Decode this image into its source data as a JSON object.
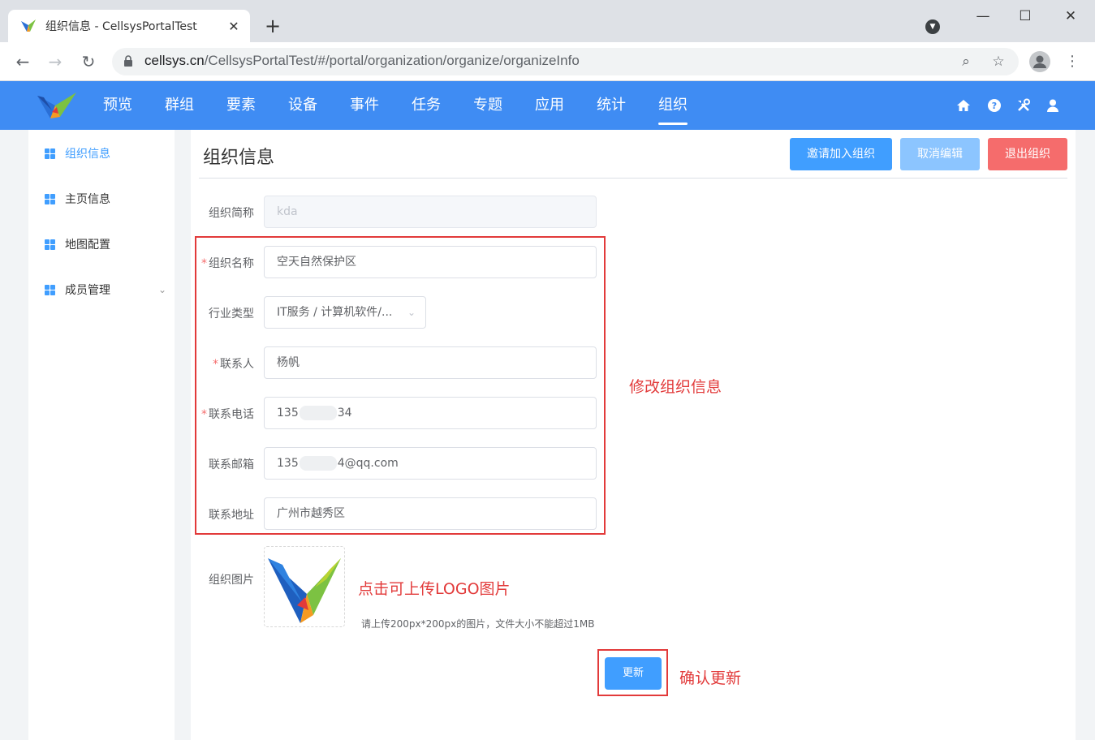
{
  "browser": {
    "tab_title": "组织信息 - CellsysPortalTest",
    "tab_close": "✕",
    "new_tab": "+",
    "url_host": "cellsys.cn",
    "url_path": "/CellsysPortalTest/#/portal/organization/organize/organizeInfo",
    "window_controls": [
      "—",
      "☐",
      "✕"
    ]
  },
  "nav": {
    "menu": [
      "预览",
      "群组",
      "要素",
      "设备",
      "事件",
      "任务",
      "专题",
      "应用",
      "统计",
      "组织"
    ],
    "active": "组织",
    "icons": [
      "home-icon",
      "help-icon",
      "tools-icon",
      "user-icon"
    ]
  },
  "sidebar": {
    "items": [
      {
        "label": "组织信息",
        "active": true
      },
      {
        "label": "主页信息",
        "active": false
      },
      {
        "label": "地图配置",
        "active": false
      },
      {
        "label": "成员管理",
        "active": false,
        "expandable": true
      }
    ]
  },
  "page": {
    "title": "组织信息",
    "buttons": {
      "invite": "邀请加入组织",
      "cancel_edit": "取消编辑",
      "exit": "退出组织"
    }
  },
  "form": {
    "short_name": {
      "label": "组织简称",
      "value": "kda",
      "disabled": true
    },
    "name": {
      "label": "组织名称",
      "required": true,
      "value": "空天自然保护区"
    },
    "industry": {
      "label": "行业类型",
      "value": "IT服务 / 计算机软件/..."
    },
    "contact": {
      "label": "联系人",
      "required": true,
      "value": "杨帆"
    },
    "phone": {
      "label": "联系电话",
      "required": true,
      "value_prefix": "135",
      "value_suffix": "34"
    },
    "email": {
      "label": "联系邮箱",
      "value_prefix": "135",
      "value_suffix": "4@qq.com"
    },
    "address": {
      "label": "联系地址",
      "value": "广州市越秀区"
    },
    "image": {
      "label": "组织图片",
      "tip": "请上传200px*200px的图片，文件大小不能超过1MB"
    },
    "submit": "更新"
  },
  "annotations": {
    "edit_info": "修改组织信息",
    "upload_logo": "点击可上传LOGO图片",
    "confirm_update": "确认更新"
  },
  "colors": {
    "primary": "#409eff",
    "header": "#3f8cf3",
    "danger": "#f56c6c",
    "annotation": "#e23a3a"
  }
}
